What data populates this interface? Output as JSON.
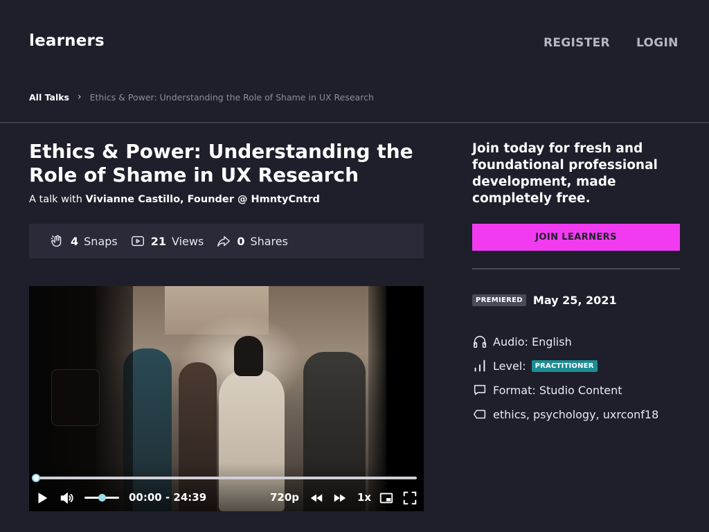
{
  "header": {
    "logo": "learners",
    "register_label": "REGISTER",
    "login_label": "LOGIN"
  },
  "breadcrumb": {
    "home": "All Talks",
    "current": "Ethics & Power: Understanding the Role of Shame in UX Research"
  },
  "talk": {
    "title": "Ethics & Power: Understanding the Role of Shame in UX Research",
    "byline_prefix": "A talk with",
    "speaker": "Vivianne Castillo, Founder @ HmntyCntrd"
  },
  "stats": {
    "snaps_count": "4",
    "snaps_label": "Snaps",
    "views_count": "21",
    "views_label": "Views",
    "shares_count": "0",
    "shares_label": "Shares"
  },
  "player": {
    "time": "00:00 - 24:39",
    "quality": "720p",
    "speed": "1x",
    "progress_fraction": 0.0,
    "volume_fraction": 0.5
  },
  "sidebar": {
    "cta_text": "Join today for fresh and foundational professional development, made completely free.",
    "join_button": "JOIN LEARNERS",
    "premiered_badge": "PREMIERED",
    "premiered_date": "May 25, 2021",
    "audio": "Audio: English",
    "level_prefix": "Level:",
    "level_badge": "PRACTITIONER",
    "format": "Format: Studio Content",
    "tags": "ethics, psychology, uxrconf18"
  },
  "colors": {
    "background": "#1f1e2b",
    "accent": "#f23bf0",
    "level_badge": "#1d8c93",
    "stats_bg": "#2a2a38"
  }
}
